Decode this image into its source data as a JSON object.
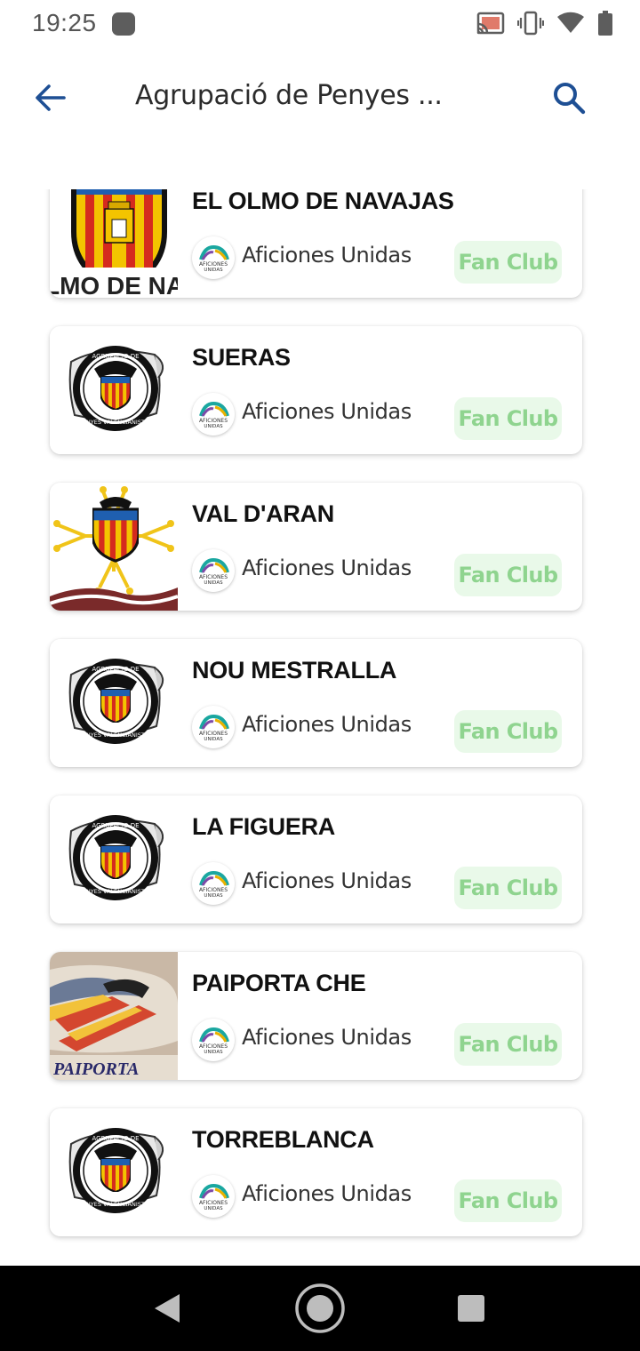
{
  "status_bar": {
    "time": "19:25"
  },
  "app_bar": {
    "title": "Agrupació de Penyes ...",
    "back_icon": "arrow-back-icon",
    "search_icon": "search-icon"
  },
  "colors": {
    "accent": "#1e4f94",
    "badge_bg": "#e9f9e9",
    "badge_text": "#8fd48f"
  },
  "items": [
    {
      "name": "EL OLMO DE NAVAJAS",
      "organization": "Aficiones Unidas",
      "badge": "Fan Club",
      "logo_icon": "valencia-crest-icon",
      "logo_caption": "LMO DE NAV"
    },
    {
      "name": "SUERAS",
      "organization": "Aficiones Unidas",
      "badge": "Fan Club",
      "logo_icon": "agrupacio-penyes-logo-icon"
    },
    {
      "name": "VAL D'ARAN",
      "organization": "Aficiones Unidas",
      "badge": "Fan Club",
      "logo_icon": "valencia-cross-crest-icon"
    },
    {
      "name": "NOU MESTRALLA",
      "organization": "Aficiones Unidas",
      "badge": "Fan Club",
      "logo_icon": "agrupacio-penyes-logo-icon"
    },
    {
      "name": "LA FIGUERA",
      "organization": "Aficiones Unidas",
      "badge": "Fan Club",
      "logo_icon": "agrupacio-penyes-logo-icon"
    },
    {
      "name": "PAIPORTA CHE",
      "organization": "Aficiones Unidas",
      "badge": "Fan Club",
      "logo_icon": "paiporta-banner-icon",
      "logo_caption": "PAIPORTA"
    },
    {
      "name": "TORREBLANCA",
      "organization": "Aficiones Unidas",
      "badge": "Fan Club",
      "logo_icon": "agrupacio-penyes-logo-icon"
    }
  ],
  "nav_bar": {
    "back_icon": "nav-back-icon",
    "home_icon": "nav-home-icon",
    "recents_icon": "nav-recents-icon"
  }
}
